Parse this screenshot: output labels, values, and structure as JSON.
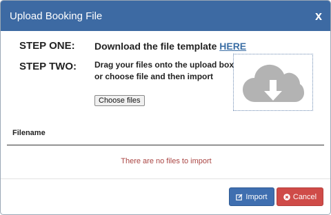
{
  "modal": {
    "title": "Upload Booking File",
    "close_glyph": "x"
  },
  "steps": {
    "one_label": "STEP ONE:",
    "one_text": "Download the file template ",
    "one_link": "HERE",
    "two_label": "STEP TWO:",
    "two_text_line1": "Drag your files onto the upload box",
    "two_text_line2": "or choose file and then import",
    "choose_files": "Choose files"
  },
  "dropzone": {
    "icon": "cloud-download-icon"
  },
  "table": {
    "column_header": "Filename",
    "empty_message": "There are no files to import"
  },
  "footer": {
    "import_label": "Import",
    "import_icon": "edit-icon",
    "cancel_label": "Cancel",
    "cancel_icon": "times-circle-icon"
  },
  "colors": {
    "header": "#3d6aa3",
    "link": "#3b6ea5",
    "empty_text": "#a94442",
    "import_button": "#3f6fb0",
    "cancel_button": "#cf4b48"
  }
}
